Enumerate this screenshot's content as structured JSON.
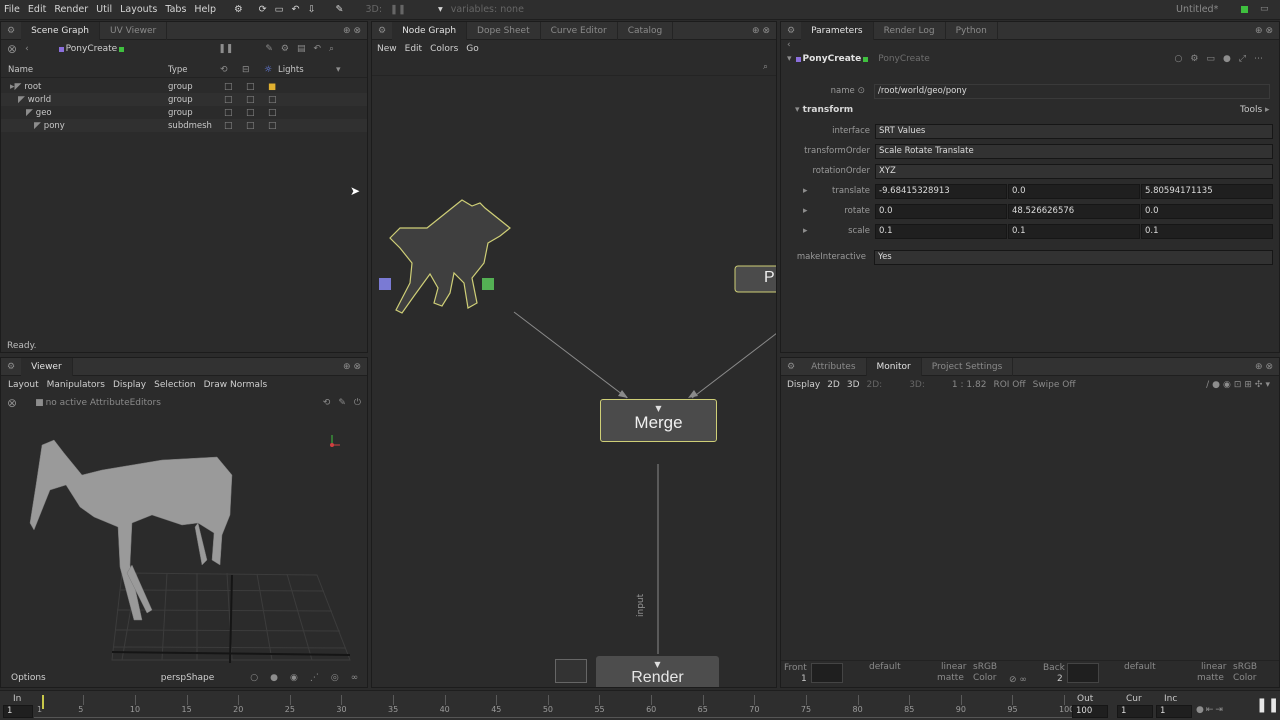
{
  "menubar": {
    "items": [
      "File",
      "Edit",
      "Render",
      "Util",
      "Layouts",
      "Tabs",
      "Help"
    ],
    "mode_3d": "3D:",
    "variables": "variables: none",
    "project": "Untitled*"
  },
  "scene_graph": {
    "tabs": [
      "Scene Graph",
      "UV Viewer"
    ],
    "node": "PonyCreate",
    "columns": [
      "Name",
      "Type",
      "Lights"
    ],
    "rows": [
      {
        "name": "root",
        "type": "group"
      },
      {
        "name": "world",
        "type": "group"
      },
      {
        "name": "geo",
        "type": "group"
      },
      {
        "name": "pony",
        "type": "subdmesh"
      }
    ],
    "status": "Ready."
  },
  "viewer": {
    "tabs": [
      "Viewer"
    ],
    "menu": [
      "Layout",
      "Manipulators",
      "Display",
      "Selection",
      "Draw Normals"
    ],
    "editors": "no active AttributeEditors",
    "options": "Options",
    "camera": "perspShape"
  },
  "node_graph": {
    "tabs": [
      "Node Graph",
      "Dope Sheet",
      "Curve Editor",
      "Catalog"
    ],
    "menu": [
      "New",
      "Edit",
      "Colors",
      "Go"
    ],
    "merge": "Merge",
    "render": "Render",
    "input_label": "input",
    "partial_node": "P"
  },
  "parameters": {
    "tabs": [
      "Parameters",
      "Render Log",
      "Python"
    ],
    "node": "PonyCreate",
    "node_ghost": "PonyCreate",
    "name_label": "name",
    "name_value": "/root/world/geo/pony",
    "group": "transform",
    "tools": "Tools",
    "interface_label": "interface",
    "interface_value": "SRT Values",
    "transformOrder_label": "transformOrder",
    "transformOrder_value": "Scale Rotate Translate",
    "rotationOrder_label": "rotationOrder",
    "rotationOrder_value": "XYZ",
    "translate_label": "translate",
    "translate": [
      "-9.68415328913",
      "0.0",
      "5.80594171135"
    ],
    "rotate_label": "rotate",
    "rotate": [
      "0.0",
      "48.526626576",
      "0.0"
    ],
    "scale_label": "scale",
    "scale": [
      "0.1",
      "0.1",
      "0.1"
    ],
    "makeInteractive_label": "makeInteractive",
    "makeInteractive_value": "Yes"
  },
  "monitor": {
    "tabs": [
      "Attributes",
      "Monitor",
      "Project Settings"
    ],
    "toolbar": [
      "Display",
      "2D",
      "3D",
      "2D:",
      "3D:",
      "1 : 1.82",
      "ROI Off",
      "Swipe Off"
    ],
    "front": "Front",
    "front_num": "1",
    "back": "Back",
    "back_num": "2",
    "default": "default",
    "linear": "linear",
    "srgb": "sRGB",
    "matte": "matte",
    "color": "Color"
  },
  "timeline": {
    "in_label": "In",
    "in_value": "1",
    "out_label": "Out",
    "out_value": "100",
    "cur_label": "Cur",
    "cur_value": "1",
    "inc_label": "Inc",
    "inc_value": "1",
    "ticks": [
      "1",
      "5",
      "10",
      "15",
      "20",
      "25",
      "30",
      "35",
      "40",
      "45",
      "50",
      "55",
      "60",
      "65",
      "70",
      "75",
      "80",
      "85",
      "90",
      "95",
      "100"
    ]
  },
  "colors": {
    "accent_node": "#cfcf77",
    "timeline_marker": "#c8c84a"
  }
}
